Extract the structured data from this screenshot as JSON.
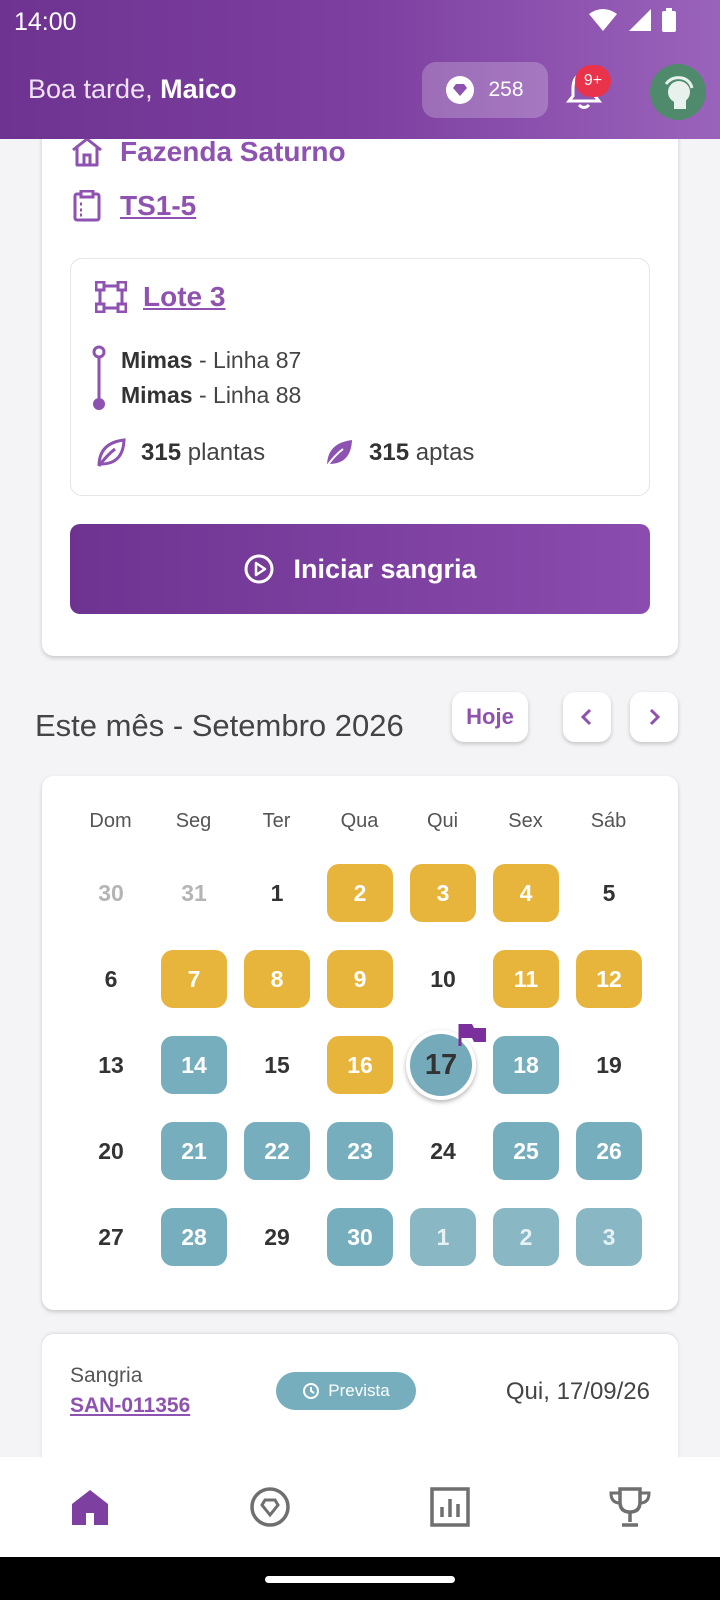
{
  "status_bar": {
    "time": "14:00"
  },
  "header": {
    "greeting_prefix": "Boa tarde, ",
    "user_name": "Maico",
    "points": "258",
    "notification_badge": "9+"
  },
  "farm": {
    "name": "Fazenda Saturno",
    "code": "TS1-5",
    "lote": "Lote 3",
    "lines": [
      {
        "name": "Mimas",
        "desc": " - Linha 87"
      },
      {
        "name": "Mimas",
        "desc": " - Linha 88"
      }
    ],
    "plants_count": "315",
    "plants_label": " plantas",
    "apt_count": "315",
    "apt_label": " aptas",
    "start_button": "Iniciar sangria"
  },
  "calendar": {
    "title": "Este mês - Setembro 2026",
    "today_button": "Hoje",
    "weekdays": [
      "Dom",
      "Seg",
      "Ter",
      "Qua",
      "Qui",
      "Sex",
      "Sáb"
    ],
    "weeks": [
      [
        "30",
        "31",
        "1",
        "2",
        "3",
        "4",
        "5"
      ],
      [
        "6",
        "7",
        "8",
        "9",
        "10",
        "11",
        "12"
      ],
      [
        "13",
        "14",
        "15",
        "16",
        "17",
        "18",
        "19"
      ],
      [
        "20",
        "21",
        "22",
        "23",
        "24",
        "25",
        "26"
      ],
      [
        "27",
        "28",
        "29",
        "30",
        "1",
        "2",
        "3"
      ]
    ],
    "colors": {
      "done": "#e8b53c",
      "planned": "#77aebd"
    }
  },
  "sangria": {
    "label": "Sangria",
    "code": "SAN-011356",
    "status": "Prevista",
    "date": "Qui, 17/09/26"
  },
  "theme": {
    "primary": "#7d3fa0",
    "accent": "#8e52b0"
  }
}
